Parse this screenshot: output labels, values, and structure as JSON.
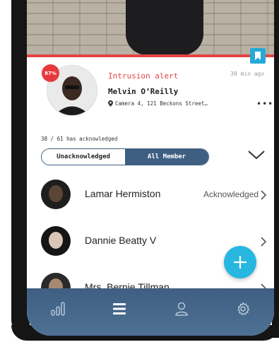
{
  "alert": {
    "confidence": "87%",
    "title": "Intrusion alert",
    "time": "30 min ago",
    "name": "Melvin O’Reilly",
    "location": "Camera 4, 121 Beckons Street…",
    "more": "•••"
  },
  "ack_summary": "38 / 61 has acknowledged",
  "tabs": [
    {
      "label": "Unacknowledged",
      "active": false
    },
    {
      "label": "All Member",
      "active": true
    }
  ],
  "members": [
    {
      "name": "Lamar Hermiston",
      "status": "Acknowledged"
    },
    {
      "name": "Dannie Beatty V",
      "status": ""
    },
    {
      "name": "Mrs. Bernie Tillman",
      "status": ""
    }
  ],
  "icons": {
    "bookmark": "bookmark-icon",
    "location": "location-pin-icon",
    "expand": "chevron-down-icon",
    "row": "chevron-right-icon",
    "fab": "plus-icon",
    "nav": [
      "stats-icon",
      "list-icon",
      "user-icon",
      "gear-icon"
    ]
  },
  "colors": {
    "accent": "#e54343",
    "primary": "#3f5f82",
    "fab": "#27b6e0"
  }
}
